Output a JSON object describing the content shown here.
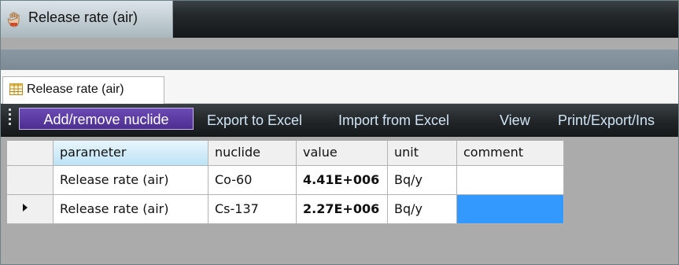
{
  "window": {
    "title": "Release rate (air)",
    "icon": "app-hand-icon"
  },
  "tab": {
    "label": "Release rate (air)",
    "icon": "table-icon"
  },
  "menu": {
    "items": [
      {
        "label": "Add/remove nuclide"
      },
      {
        "label": "Export to Excel"
      },
      {
        "label": "Import from Excel"
      },
      {
        "label": "View"
      },
      {
        "label": "Print/Export/Ins"
      }
    ]
  },
  "grid": {
    "columns": [
      "parameter",
      "nuclide",
      "value",
      "unit",
      "comment"
    ],
    "rows": [
      {
        "parameter": "Release rate (air)",
        "nuclide": "Co-60",
        "value": "4.41E+006",
        "unit": "Bq/y",
        "comment": ""
      },
      {
        "parameter": "Release rate (air)",
        "nuclide": "Cs-137",
        "value": "2.27E+006",
        "unit": "Bq/y",
        "comment": ""
      }
    ],
    "current_row_indicator": "row-pointer-icon"
  },
  "colors": {
    "menubar": "#1c2022",
    "menu_text": "#cfe4f4",
    "active_menu": "#5a3aa3",
    "selected_cell": "#3399ff",
    "background": "#ababab"
  }
}
